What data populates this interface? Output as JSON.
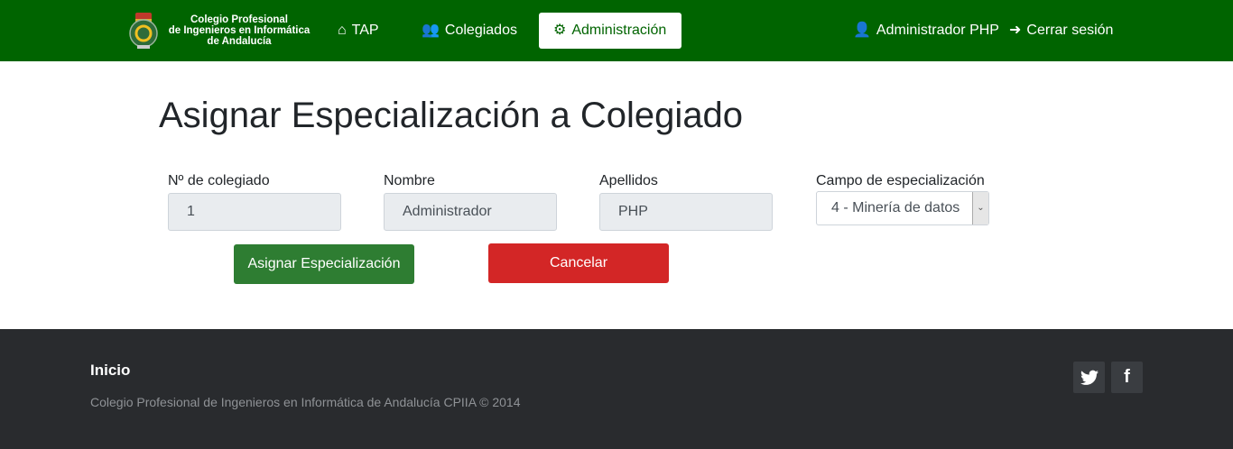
{
  "nav": {
    "brand": "Colegio Profesional de Ingenieros en Informática de Andalucía",
    "brand_lines": [
      "Colegio Profesional",
      "de Ingenieros en Informática",
      "de Andalucía"
    ],
    "items": [
      {
        "label": "TAP",
        "icon": "home-icon"
      },
      {
        "label": "Colegiados",
        "icon": "users-icon"
      },
      {
        "label": "Administración",
        "icon": "gear-icon",
        "active": true
      }
    ],
    "user": "Administrador PHP",
    "logout": "Cerrar sesión"
  },
  "page": {
    "title": "Asignar Especialización a Colegiado",
    "fields": [
      {
        "label": "Nº de colegiado",
        "value": "1"
      },
      {
        "label": "Nombre",
        "value": "Administrador"
      },
      {
        "label": "Apellidos",
        "value": "PHP"
      }
    ],
    "select": {
      "label": "Campo de especialización *",
      "value": "4 - Minería de datos"
    },
    "assign_button": "Asignar Especialización",
    "cancel_button": "Cancelar"
  },
  "footer": {
    "title": "Inicio",
    "copyright": "Colegio Profesional de Ingenieros en Informática de Andalucía CPIIA © 2014",
    "social": [
      "twitter-icon",
      "facebook-icon"
    ]
  },
  "colors": {
    "navbar": "#006400",
    "assign": "#2e7d32",
    "cancel": "#d32626",
    "footer": "#292b2e"
  }
}
